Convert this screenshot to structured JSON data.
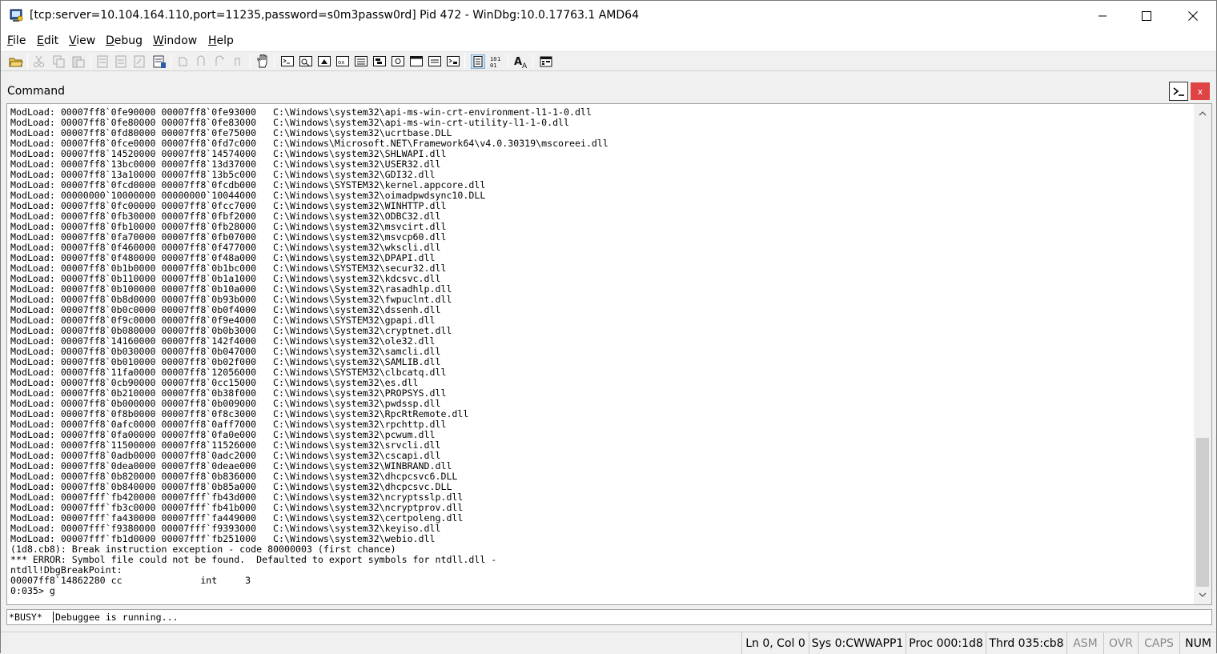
{
  "window": {
    "title": "[tcp:server=10.104.164.110,port=11235,password=s0m3passw0rd] Pid 472 - WinDbg:10.0.17763.1 AMD64",
    "app_icon": "windbg-icon"
  },
  "menu": {
    "items": [
      {
        "label": "File",
        "accel": "F",
        "rest": "ile"
      },
      {
        "label": "Edit",
        "accel": "E",
        "rest": "dit"
      },
      {
        "label": "View",
        "accel": "V",
        "rest": "iew"
      },
      {
        "label": "Debug",
        "accel": "D",
        "rest": "ebug"
      },
      {
        "label": "Window",
        "accel": "W",
        "rest": "indow"
      },
      {
        "label": "Help",
        "accel": "H",
        "rest": "elp"
      }
    ]
  },
  "command_window": {
    "title": "Command",
    "close_label": "x",
    "output": [
      "ModLoad: 00007ff8`0fe90000 00007ff8`0fe93000   C:\\Windows\\system32\\api-ms-win-crt-environment-l1-1-0.dll",
      "ModLoad: 00007ff8`0fe80000 00007ff8`0fe83000   C:\\Windows\\system32\\api-ms-win-crt-utility-l1-1-0.dll",
      "ModLoad: 00007ff8`0fd80000 00007ff8`0fe75000   C:\\Windows\\system32\\ucrtbase.DLL",
      "ModLoad: 00007ff8`0fce0000 00007ff8`0fd7c000   C:\\Windows\\Microsoft.NET\\Framework64\\v4.0.30319\\mscoreei.dll",
      "ModLoad: 00007ff8`14520000 00007ff8`14574000   C:\\Windows\\system32\\SHLWAPI.dll",
      "ModLoad: 00007ff8`13bc0000 00007ff8`13d37000   C:\\Windows\\system32\\USER32.dll",
      "ModLoad: 00007ff8`13a10000 00007ff8`13b5c000   C:\\Windows\\system32\\GDI32.dll",
      "ModLoad: 00007ff8`0fcd0000 00007ff8`0fcdb000   C:\\Windows\\SYSTEM32\\kernel.appcore.dll",
      "ModLoad: 00000000`10000000 00000000`10044000   C:\\Windows\\system32\\oimadpwdsync10.DLL",
      "ModLoad: 00007ff8`0fc00000 00007ff8`0fcc7000   C:\\Windows\\system32\\WINHTTP.dll",
      "ModLoad: 00007ff8`0fb30000 00007ff8`0fbf2000   C:\\Windows\\system32\\ODBC32.dll",
      "ModLoad: 00007ff8`0fb10000 00007ff8`0fb28000   C:\\Windows\\system32\\msvcirt.dll",
      "ModLoad: 00007ff8`0fa70000 00007ff8`0fb07000   C:\\Windows\\system32\\msvcp60.dll",
      "ModLoad: 00007ff8`0f460000 00007ff8`0f477000   C:\\Windows\\system32\\wkscli.dll",
      "ModLoad: 00007ff8`0f480000 00007ff8`0f48a000   C:\\Windows\\system32\\DPAPI.dll",
      "ModLoad: 00007ff8`0b1b0000 00007ff8`0b1bc000   C:\\Windows\\SYSTEM32\\secur32.dll",
      "ModLoad: 00007ff8`0b110000 00007ff8`0b1a1000   C:\\Windows\\system32\\kdcsvc.dll",
      "ModLoad: 00007ff8`0b100000 00007ff8`0b10a000   C:\\Windows\\System32\\rasadhlp.dll",
      "ModLoad: 00007ff8`0b8d0000 00007ff8`0b93b000   C:\\Windows\\System32\\fwpuclnt.dll",
      "ModLoad: 00007ff8`0b0c0000 00007ff8`0b0f4000   C:\\Windows\\system32\\dssenh.dll",
      "ModLoad: 00007ff8`0f9c0000 00007ff8`0f9e4000   C:\\Windows\\SYSTEM32\\gpapi.dll",
      "ModLoad: 00007ff8`0b080000 00007ff8`0b0b3000   C:\\Windows\\System32\\cryptnet.dll",
      "ModLoad: 00007ff8`14160000 00007ff8`142f4000   C:\\Windows\\system32\\ole32.dll",
      "ModLoad: 00007ff8`0b030000 00007ff8`0b047000   C:\\Windows\\system32\\samcli.dll",
      "ModLoad: 00007ff8`0b010000 00007ff8`0b02f000   C:\\Windows\\system32\\SAMLIB.dll",
      "ModLoad: 00007ff8`11fa0000 00007ff8`12056000   C:\\Windows\\SYSTEM32\\clbcatq.dll",
      "ModLoad: 00007ff8`0cb90000 00007ff8`0cc15000   C:\\Windows\\system32\\es.dll",
      "ModLoad: 00007ff8`0b210000 00007ff8`0b38f000   C:\\Windows\\system32\\PROPSYS.dll",
      "ModLoad: 00007ff8`0b000000 00007ff8`0b009000   C:\\Windows\\system32\\pwdssp.dll",
      "ModLoad: 00007ff8`0f8b0000 00007ff8`0f8c3000   C:\\Windows\\system32\\RpcRtRemote.dll",
      "ModLoad: 00007ff8`0afc0000 00007ff8`0aff7000   C:\\Windows\\system32\\rpchttp.dll",
      "ModLoad: 00007ff8`0fa00000 00007ff8`0fa0e000   C:\\Windows\\system32\\pcwum.dll",
      "ModLoad: 00007ff8`11500000 00007ff8`11526000   C:\\Windows\\system32\\srvcli.dll",
      "ModLoad: 00007ff8`0adb0000 00007ff8`0adc2000   C:\\Windows\\system32\\cscapi.dll",
      "ModLoad: 00007ff8`0dea0000 00007ff8`0deae000   C:\\Windows\\system32\\WINBRAND.dll",
      "ModLoad: 00007ff8`0b820000 00007ff8`0b836000   C:\\Windows\\system32\\dhcpcsvc6.DLL",
      "ModLoad: 00007ff8`0b840000 00007ff8`0b85a000   C:\\Windows\\system32\\dhcpcsvc.DLL",
      "ModLoad: 00007fff`fb420000 00007fff`fb43d000   C:\\Windows\\system32\\ncryptsslp.dll",
      "ModLoad: 00007fff`fb3c0000 00007fff`fb41b000   C:\\Windows\\system32\\ncryptprov.dll",
      "ModLoad: 00007fff`fa430000 00007fff`fa449000   C:\\Windows\\system32\\certpoleng.dll",
      "ModLoad: 00007fff`f9380000 00007fff`f9393000   C:\\Windows\\system32\\keyiso.dll",
      "ModLoad: 00007fff`fb1d0000 00007fff`fb251000   C:\\Windows\\system32\\webio.dll",
      "(1d8.cb8): Break instruction exception - code 80000003 (first chance)",
      "*** ERROR: Symbol file could not be found.  Defaulted to export symbols for ntdll.dll -",
      "ntdll!DbgBreakPoint:",
      "00007ff8`14862280 cc              int     3",
      "0:035> g"
    ],
    "busy_label": "*BUSY*",
    "input_value": "Debuggee is running..."
  },
  "statusbar": {
    "position": "Ln 0, Col 0",
    "sys": "Sys 0:CWWAPP1",
    "proc": "Proc 000:1d8",
    "thrd": "Thrd 035:cb8",
    "asm": "ASM",
    "ovr": "OVR",
    "caps": "CAPS",
    "num": "NUM"
  }
}
